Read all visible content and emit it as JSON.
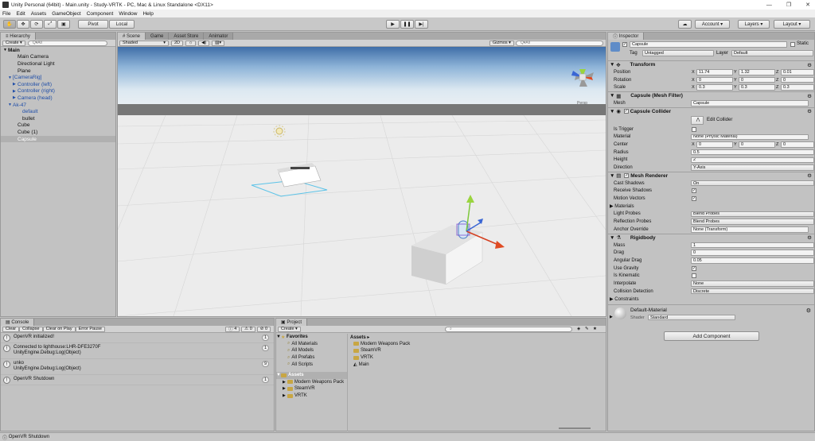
{
  "window": {
    "title": "Unity Personal (64bit) - Main.unity - Study-VRTK - PC, Mac & Linux Standalone <DX11>"
  },
  "menu": [
    "File",
    "Edit",
    "Assets",
    "GameObject",
    "Component",
    "Window",
    "Help"
  ],
  "toolbar": {
    "pivot": "Pivot",
    "local": "Local",
    "account": "Account",
    "layers": "Layers",
    "layout": "Layout"
  },
  "hierarchy": {
    "tab": "Hierarchy",
    "create": "Create",
    "search_placeholder": "Q▾All",
    "items": [
      {
        "label": "Main",
        "indent": 0,
        "prefix": "▼",
        "bold": true,
        "blue": false
      },
      {
        "label": "Main Camera",
        "indent": 2,
        "prefix": "",
        "bold": false,
        "blue": false
      },
      {
        "label": "Directional Light",
        "indent": 2,
        "prefix": "",
        "bold": false,
        "blue": false
      },
      {
        "label": "Plane",
        "indent": 2,
        "prefix": "",
        "bold": false,
        "blue": false
      },
      {
        "label": "[CameraRig]",
        "indent": 1,
        "prefix": "▼",
        "bold": false,
        "blue": true
      },
      {
        "label": "Controller (left)",
        "indent": 2,
        "prefix": "▶",
        "bold": false,
        "blue": true
      },
      {
        "label": "Controller (right)",
        "indent": 2,
        "prefix": "▶",
        "bold": false,
        "blue": true
      },
      {
        "label": "Camera (head)",
        "indent": 2,
        "prefix": "▶",
        "bold": false,
        "blue": true
      },
      {
        "label": "Ak-47",
        "indent": 1,
        "prefix": "▼",
        "bold": false,
        "blue": true
      },
      {
        "label": "default",
        "indent": 3,
        "prefix": "",
        "bold": false,
        "blue": true
      },
      {
        "label": "bullet",
        "indent": 3,
        "prefix": "",
        "bold": false,
        "blue": false
      },
      {
        "label": "Cube",
        "indent": 2,
        "prefix": "",
        "bold": false,
        "blue": false
      },
      {
        "label": "Cube (1)",
        "indent": 2,
        "prefix": "",
        "bold": false,
        "blue": false
      },
      {
        "label": "Capsule",
        "indent": 2,
        "prefix": "",
        "bold": false,
        "blue": false,
        "selected": true
      }
    ]
  },
  "scene": {
    "tabs": [
      "# Scene",
      "Game",
      "Asset Store",
      "Animator"
    ],
    "shading": "Shaded",
    "mode2d": "2D",
    "gizmos": "Gizmos",
    "gizmo_search": "Q▾All",
    "persp": "Persp"
  },
  "inspector": {
    "tab": "Inspector",
    "object_name": "Capsule",
    "static": "Static",
    "tag_label": "Tag",
    "tag": "Untagged",
    "layer_label": "Layer",
    "layer": "Default",
    "transform": {
      "title": "Transform",
      "position_label": "Position",
      "pos": [
        "11.74",
        "1.32",
        "0.01"
      ],
      "rotation_label": "Rotation",
      "rot": [
        "0",
        "0",
        "0"
      ],
      "scale_label": "Scale",
      "scale": [
        "0.3",
        "0.3",
        "0.3"
      ]
    },
    "mesh_filter": {
      "title": "Capsule (Mesh Filter)",
      "mesh_label": "Mesh",
      "mesh": "Capsule"
    },
    "collider": {
      "title": "Capsule Collider",
      "edit": "Edit Collider",
      "is_trigger_label": "Is Trigger",
      "material_label": "Material",
      "material": "None (Physic Material)",
      "center_label": "Center",
      "center": [
        "0",
        "0",
        "0"
      ],
      "radius_label": "Radius",
      "radius": "0.5",
      "height_label": "Height",
      "height": "2",
      "direction_label": "Direction",
      "direction": "Y-Axis"
    },
    "renderer": {
      "title": "Mesh Renderer",
      "cast_label": "Cast Shadows",
      "cast": "On",
      "receive_label": "Receive Shadows",
      "motion_label": "Motion Vectors",
      "materials_label": "Materials",
      "light_probes_label": "Light Probes",
      "light_probes": "Blend Probes",
      "reflection_label": "Reflection Probes",
      "reflection": "Blend Probes",
      "anchor_label": "Anchor Override",
      "anchor": "None (Transform)"
    },
    "rigidbody": {
      "title": "Rigidbody",
      "mass_label": "Mass",
      "mass": "1",
      "drag_label": "Drag",
      "drag": "0",
      "angular_label": "Angular Drag",
      "angular": "0.05",
      "gravity_label": "Use Gravity",
      "kinematic_label": "Is Kinematic",
      "interp_label": "Interpolate",
      "interp": "None",
      "collision_label": "Collision Detection",
      "collision": "Discrete",
      "constraints_label": "Constraints"
    },
    "material": {
      "name": "Default-Material",
      "shader_label": "Shader",
      "shader": "Standard"
    },
    "add_component": "Add Component",
    "axes": [
      "X",
      "Y",
      "Z"
    ]
  },
  "console": {
    "tab": "Console",
    "buttons": [
      "Clear",
      "Collapse",
      "Clear on Play",
      "Error Pause"
    ],
    "counts": [
      "4",
      "0",
      "0"
    ],
    "rows": [
      {
        "line1": "OpenVR initialized!",
        "line2": "",
        "count": "1"
      },
      {
        "line1": "Connected to lighthouse:LHR-DFE3270F",
        "line2": "UnityEngine.Debug:Log(Object)",
        "count": "1"
      },
      {
        "line1": "unko",
        "line2": "UnityEngine.Debug:Log(Object)",
        "count": "9"
      },
      {
        "line1": "OpenVR Shutdown",
        "line2": "",
        "count": "1"
      }
    ]
  },
  "project": {
    "tab": "Project",
    "create": "Create",
    "favorites": "Favorites",
    "fav_items": [
      "All Materials",
      "All Models",
      "All Prefabs",
      "All Scripts"
    ],
    "assets": "Assets",
    "asset_tree": [
      "Modern Weapons Pack",
      "SteamVR",
      "VRTK"
    ],
    "breadcrumb": "Assets ▸",
    "asset_list": [
      "Modern Weapons Pack",
      "SteamVR",
      "VRTK",
      "Main"
    ]
  },
  "status": "OpenVR Shutdown"
}
